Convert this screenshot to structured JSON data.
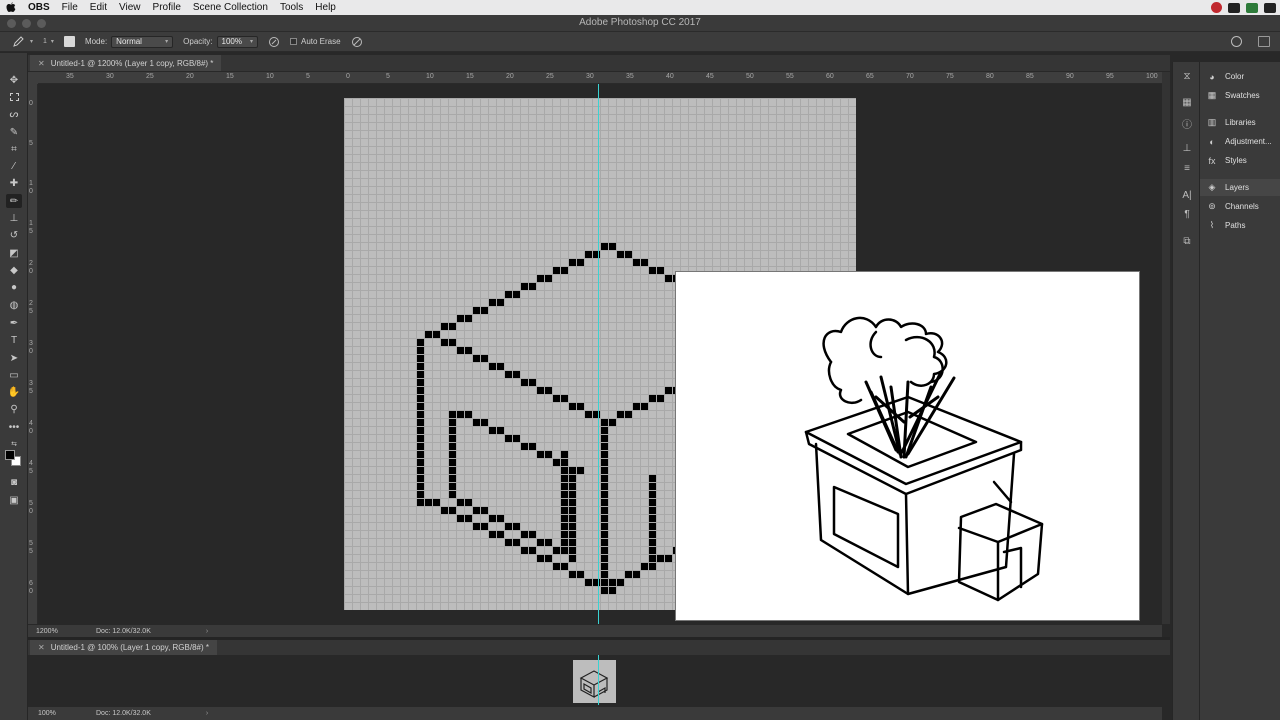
{
  "macos_menubar": {
    "app": "OBS",
    "items": [
      "File",
      "Edit",
      "View",
      "Profile",
      "Scene Collection",
      "Tools",
      "Help"
    ]
  },
  "window": {
    "title": "Adobe Photoshop CC 2017"
  },
  "options_bar": {
    "mode_label": "Mode:",
    "mode_value": "Normal",
    "opacity_label": "Opacity:",
    "opacity_value": "100%",
    "auto_erase_label": "Auto Erase",
    "brush_size": "1"
  },
  "document_1": {
    "tab_title": "Untitled-1 @ 1200% (Layer 1 copy, RGB/8#) *",
    "zoom": "1200%",
    "doc_size": "Doc: 12.0K/32.0K"
  },
  "document_2": {
    "tab_title": "Untitled-1 @ 100% (Layer 1 copy, RGB/8#) *",
    "zoom": "100%",
    "doc_size": "Doc: 12.0K/32.0K"
  },
  "ruler": {
    "top_labels": [
      "35",
      "30",
      "25",
      "20",
      "15",
      "10",
      "5",
      "0",
      "5",
      "10",
      "15",
      "20",
      "25",
      "30",
      "35",
      "40",
      "45",
      "50",
      "55",
      "60",
      "65",
      "70",
      "75",
      "80",
      "85",
      "90",
      "95",
      "100"
    ],
    "left_labels": [
      "0",
      "5",
      "1 0",
      "1 5",
      "2 0",
      "2 5",
      "3 0",
      "3 5",
      "4 0",
      "4 5",
      "5 0",
      "5 5",
      "6 0"
    ]
  },
  "panels": {
    "group1": [
      "Color",
      "Swatches"
    ],
    "group2": [
      "Libraries",
      "Adjustment...",
      "Styles"
    ],
    "group3": [
      "Layers",
      "Channels",
      "Paths"
    ]
  },
  "colors": {
    "foreground": "#000000",
    "background": "#ffffff",
    "guide": "#3ad2d2",
    "pixel_canvas": "#bdbdbd"
  }
}
